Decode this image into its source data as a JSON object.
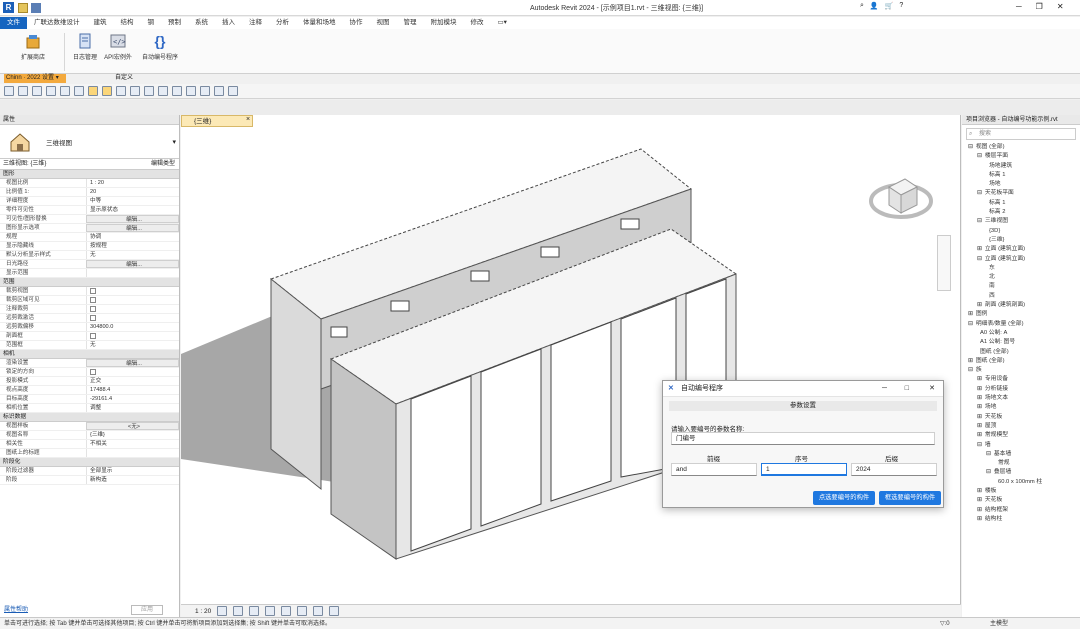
{
  "window": {
    "title": "Autodesk Revit 2024 - [示例项目1.rvt - 三维视图: {三维}]",
    "minimize": "─",
    "restore": "❐",
    "close": "✕"
  },
  "menu": {
    "items": [
      "文件",
      "广联达数维设计",
      "建筑",
      "结构",
      "钢",
      "预制",
      "系统",
      "插入",
      "注释",
      "分析",
      "体量和场地",
      "协作",
      "视图",
      "管理",
      "附加模块",
      "修改",
      "▭▾"
    ],
    "active": 0
  },
  "ribbon": {
    "buttons": [
      {
        "label": "扩展商店",
        "icon": "package-icon"
      },
      {
        "label": "日志管理",
        "icon": "document-icon"
      },
      {
        "label": "API宏例外",
        "icon": "code-icon"
      },
      {
        "label": "自动编号程序",
        "icon": "braces-icon"
      }
    ],
    "panel_left": "Chinn · 2022 设置 ▾",
    "panel_right": "自定义"
  },
  "view_tab": {
    "label": "{三维}",
    "close": "×"
  },
  "properties": {
    "header": "属性",
    "type_name": "三维视图",
    "selector": "三维视图: {三维}",
    "edit_type": "编辑类型",
    "sections": [
      {
        "title": "图形",
        "rows": [
          [
            "视图比例",
            "1 : 20",
            ""
          ],
          [
            "比例值 1:",
            "20",
            ""
          ],
          [
            "详细程度",
            "中等",
            ""
          ],
          [
            "零件可见性",
            "显示原状态",
            ""
          ],
          [
            "可见性/图形替换",
            "编辑...",
            "btn"
          ],
          [
            "图形显示选项",
            "编辑...",
            "btn"
          ],
          [
            "规程",
            "协调",
            ""
          ],
          [
            "显示隐藏线",
            "按规程",
            ""
          ],
          [
            "默认分析显示样式",
            "无",
            ""
          ],
          [
            "日光路径",
            "编辑...",
            "btn"
          ],
          [
            "显示范围",
            "",
            ""
          ]
        ]
      },
      {
        "title": "范围",
        "rows": [
          [
            "裁剪视图",
            "",
            "cb"
          ],
          [
            "裁剪区域可见",
            "",
            "cb"
          ],
          [
            "注释裁剪",
            "",
            "cb"
          ],
          [
            "远剪裁激活",
            "",
            "cb"
          ],
          [
            "远剪裁偏移",
            "304800.0",
            ""
          ],
          [
            "剖面框",
            "",
            "cb"
          ],
          [
            "范围框",
            "无",
            ""
          ]
        ]
      },
      {
        "title": "相机",
        "rows": [
          [
            "渲染设置",
            "编辑...",
            "btn"
          ],
          [
            "锁定的方向",
            "",
            "cb"
          ],
          [
            "投影模式",
            "正交",
            ""
          ],
          [
            "视点高度",
            "17488.4",
            ""
          ],
          [
            "目标高度",
            "-29161.4",
            ""
          ],
          [
            "相机位置",
            "调整",
            ""
          ]
        ]
      },
      {
        "title": "标识数据",
        "rows": [
          [
            "视图样板",
            "<无>",
            "btn"
          ],
          [
            "视图名称",
            "{三维}",
            ""
          ],
          [
            "相关性",
            "不相关",
            ""
          ],
          [
            "图纸上的标题",
            "",
            ""
          ]
        ]
      },
      {
        "title": "阶段化",
        "rows": [
          [
            "阶段过滤器",
            "全部显示",
            ""
          ],
          [
            "阶段",
            "新构造",
            ""
          ]
        ]
      }
    ],
    "help": "属性帮助",
    "apply": "应用"
  },
  "view_status": {
    "scale": "1 : 20"
  },
  "browser": {
    "header": "项目浏览器 - 自动编号功能示例.rvt",
    "search_placeholder": "搜索",
    "nodes": [
      {
        "t": "视图 (全部)",
        "d": 0,
        "e": "⊟"
      },
      {
        "t": "楼层平面",
        "d": 1,
        "e": "⊟"
      },
      {
        "t": "场地建筑",
        "d": 2,
        "e": ""
      },
      {
        "t": "标高 1",
        "d": 2,
        "e": ""
      },
      {
        "t": "场地",
        "d": 2,
        "e": ""
      },
      {
        "t": "天花板平面",
        "d": 1,
        "e": "⊟"
      },
      {
        "t": "标高 1",
        "d": 2,
        "e": ""
      },
      {
        "t": "标高 2",
        "d": 2,
        "e": ""
      },
      {
        "t": "三维视图",
        "d": 1,
        "e": "⊟"
      },
      {
        "t": "{3D}",
        "d": 2,
        "e": ""
      },
      {
        "t": "{三维}",
        "d": 2,
        "e": ""
      },
      {
        "t": "立面 (建筑立面)",
        "d": 1,
        "e": "⊞"
      },
      {
        "t": "立面 (建筑立面)",
        "d": 1,
        "e": "⊟"
      },
      {
        "t": "东",
        "d": 2,
        "e": ""
      },
      {
        "t": "北",
        "d": 2,
        "e": ""
      },
      {
        "t": "南",
        "d": 2,
        "e": ""
      },
      {
        "t": "西",
        "d": 2,
        "e": ""
      },
      {
        "t": "剖面 (建筑剖面)",
        "d": 1,
        "e": "⊞"
      },
      {
        "t": "图例",
        "d": 0,
        "e": "⊞"
      },
      {
        "t": "明细表/数量 (全部)",
        "d": 0,
        "e": "⊟"
      },
      {
        "t": "A0 公制: A",
        "d": 1,
        "e": ""
      },
      {
        "t": "A1 公制: 图号",
        "d": 1,
        "e": ""
      },
      {
        "t": "图纸 (全部)",
        "d": 1,
        "e": ""
      },
      {
        "t": "图纸 (全部)",
        "d": 0,
        "e": "⊞"
      },
      {
        "t": "族",
        "d": 0,
        "e": "⊟"
      },
      {
        "t": "专用设备",
        "d": 1,
        "e": "⊞"
      },
      {
        "t": "分析链接",
        "d": 1,
        "e": "⊞"
      },
      {
        "t": "场地文本",
        "d": 1,
        "e": "⊞"
      },
      {
        "t": "场地",
        "d": 1,
        "e": "⊞"
      },
      {
        "t": "天花板",
        "d": 1,
        "e": "⊞"
      },
      {
        "t": "屋顶",
        "d": 1,
        "e": "⊞"
      },
      {
        "t": "常规模型",
        "d": 1,
        "e": "⊞"
      },
      {
        "t": "墙",
        "d": 1,
        "e": "⊟"
      },
      {
        "t": "基本墙",
        "d": 2,
        "e": "⊟"
      },
      {
        "t": "常规",
        "d": 3,
        "e": ""
      },
      {
        "t": "叠层墙",
        "d": 2,
        "e": "⊟"
      },
      {
        "t": "60.0 x 100mm 柱",
        "d": 3,
        "e": ""
      },
      {
        "t": "楼板",
        "d": 1,
        "e": "⊞"
      },
      {
        "t": "天花板",
        "d": 1,
        "e": "⊞"
      },
      {
        "t": "结构框架",
        "d": 1,
        "e": "⊞"
      },
      {
        "t": "结构柱",
        "d": 1,
        "e": "⊞"
      }
    ]
  },
  "status_text": "单击可进行选择; 按 Tab 键并单击可选择其他项目; 按 Ctrl 键并单击可将新项目添加到选择集; 按 Shift 键并单击可取消选择。",
  "status_right": {
    "filter": "▽:0",
    "model": "主模型"
  },
  "dialog": {
    "title": "自动编号程序",
    "section": "参数设置",
    "prompt": "请输入要编号的参数名称:",
    "param_value": "门编号",
    "col_labels": [
      "前缀",
      "序号",
      "后缀"
    ],
    "prefix": "and",
    "seq": "1",
    "suffix": "2024",
    "btn_pick": "点选要编号的构件",
    "btn_frame": "框选要编号的构件",
    "minimize": "─",
    "maximize": "□",
    "close": "✕"
  }
}
